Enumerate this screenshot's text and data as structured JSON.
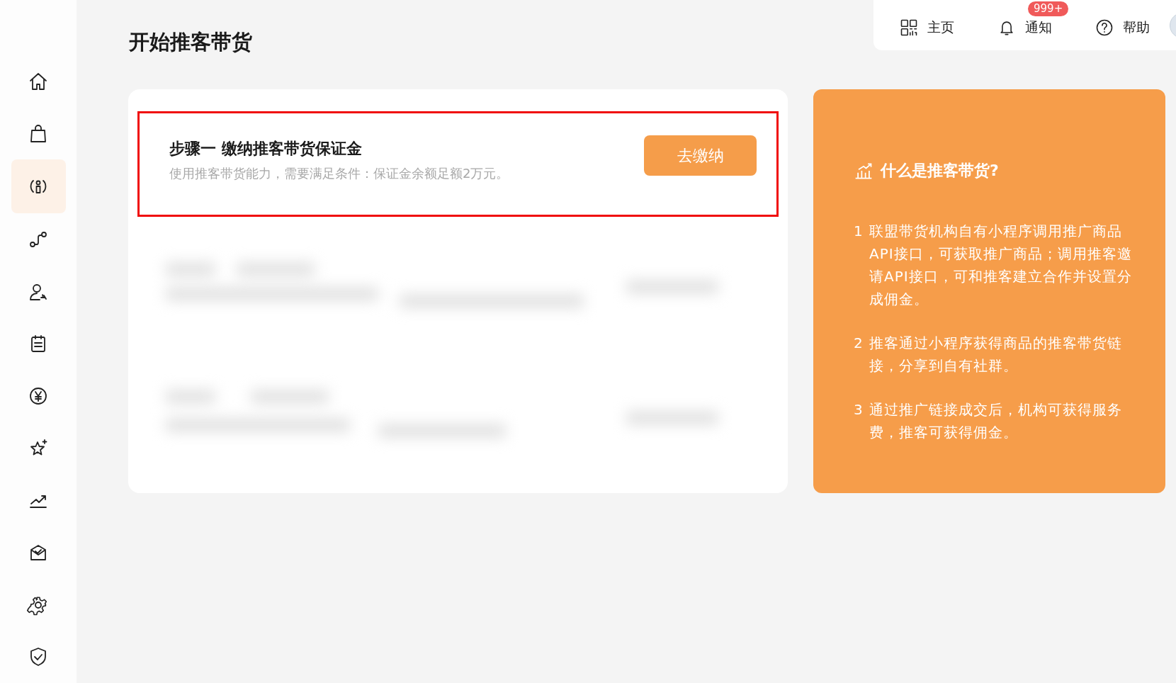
{
  "sidebar": {
    "items": [
      {
        "selected": false
      },
      {
        "selected": false
      },
      {
        "selected": true
      },
      {
        "selected": false
      },
      {
        "selected": false
      },
      {
        "selected": false
      },
      {
        "selected": false
      },
      {
        "selected": false
      },
      {
        "selected": false
      },
      {
        "selected": false
      },
      {
        "selected": false
      },
      {
        "selected": false
      }
    ]
  },
  "page_title": "开始推客带货",
  "top_bar": {
    "items": [
      {
        "label": "主页"
      },
      {
        "label": "通知",
        "badge": "999+"
      },
      {
        "label": "帮助"
      }
    ]
  },
  "step_card": {
    "title": "步骤一 缴纳推客带货保证金",
    "description": "使用推客带货能力，需要满足条件：保证金余额足额2万元。",
    "button": "去缴纳",
    "highlighted": true
  },
  "info_panel": {
    "title": "什么是推客带货?",
    "items": [
      {
        "number": "1",
        "text": "联盟带货机构自有小程序调用推广商品API接口，可获取推广商品；调用推客邀请API接口，可和推客建立合作并设置分成佣金。"
      },
      {
        "number": "2",
        "text": "推客通过小程序获得商品的推客带货链接，分享到自有社群。"
      },
      {
        "number": "3",
        "text": "通过推广链接成交后，机构可获得服务费，推客可获得佣金。"
      }
    ]
  }
}
